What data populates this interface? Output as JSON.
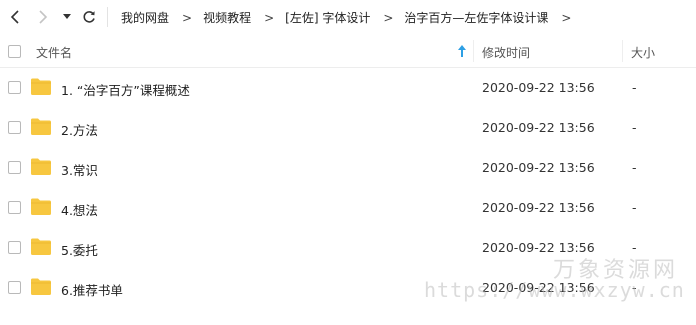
{
  "breadcrumb": [
    {
      "label": "我的网盘"
    },
    {
      "label": "视频教程"
    },
    {
      "label": "[左佐] 字体设计"
    },
    {
      "label": "治字百方—左佐字体设计课"
    }
  ],
  "columns": {
    "name": "文件名",
    "modified": "修改时间",
    "size": "大小"
  },
  "files": [
    {
      "name": "1. “治字百方”课程概述",
      "modified": "2020-09-22 13:56",
      "size": "-"
    },
    {
      "name": "2.方法",
      "modified": "2020-09-22 13:56",
      "size": "-"
    },
    {
      "name": "3.常识",
      "modified": "2020-09-22 13:56",
      "size": "-"
    },
    {
      "name": "4.想法",
      "modified": "2020-09-22 13:56",
      "size": "-"
    },
    {
      "name": "5.委托",
      "modified": "2020-09-22 13:56",
      "size": "-"
    },
    {
      "name": "6.推荐书单",
      "modified": "2020-09-22 13:56",
      "size": "-"
    }
  ],
  "watermark": {
    "brand": "万象资源网",
    "url": "https://www.wxzyw.cn"
  },
  "colors": {
    "folder": "#f7c740",
    "folder_dark": "#eab52a",
    "sort_arrow": "#2d9fe4"
  },
  "icons": {
    "back": "chevron-left-icon",
    "forward": "chevron-right-icon",
    "dropdown": "caret-down-icon",
    "refresh": "refresh-icon",
    "sort": "sort-up-icon",
    "folder": "folder-icon"
  }
}
